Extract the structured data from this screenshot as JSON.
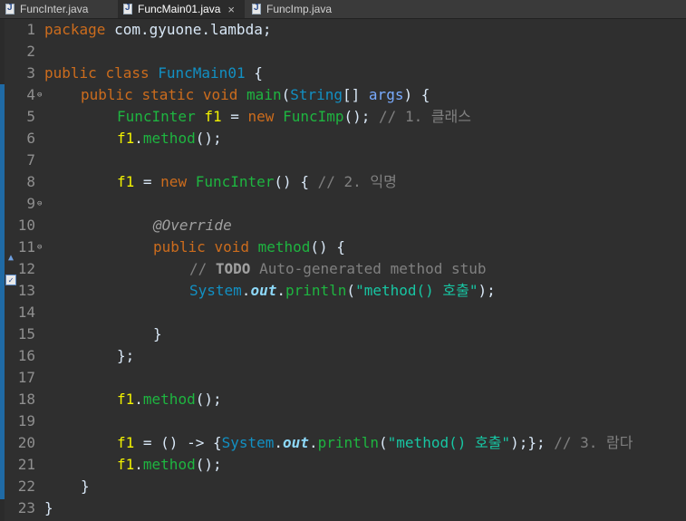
{
  "tabs": [
    {
      "label": "FuncInter.java",
      "active": false
    },
    {
      "label": "FuncMain01.java",
      "active": true,
      "close": "×"
    },
    {
      "label": "FuncImp.java",
      "active": false
    }
  ],
  "colors": {
    "keyword": "#cc6c1d",
    "class": "#1290c3",
    "method": "#1eb540",
    "string": "#17c6a3",
    "comment": "#808080",
    "background": "#2f2f2f"
  },
  "line_numbers": [
    "1",
    "2",
    "3",
    "4",
    "5",
    "6",
    "7",
    "8",
    "9",
    "10",
    "11",
    "12",
    "13",
    "14",
    "15",
    "16",
    "17",
    "18",
    "19",
    "20",
    "21",
    "22",
    "23"
  ],
  "fold_markers": {
    "4": "⊖",
    "8": "⊖",
    "10": "⊖"
  },
  "code": {
    "l1": {
      "kw": "package",
      "rest": " com.gyuone.lambda;"
    },
    "l3": {
      "kw1": "public",
      "kw2": "class",
      "name": "FuncMain01",
      "rest": " {"
    },
    "l4": {
      "kw1": "public",
      "kw2": "static",
      "kw3": "void",
      "name": "main",
      "p1": "(",
      "type": "String",
      "p2": "[] ",
      "param": "args",
      "p3": ") {"
    },
    "l5": {
      "type": "FuncInter",
      "var": "f1",
      "eq": " = ",
      "kw": "new",
      "cls": "FuncImp",
      "p": "();",
      "cmt": " // 1. 클래스"
    },
    "l6": {
      "var": "f1",
      "dot": ".",
      "meth": "method",
      "p": "();"
    },
    "l8": {
      "var": "f1",
      "eq": " = ",
      "kw": "new",
      "cls": "FuncInter",
      "p": "() {",
      "cmt": " // 2. 익명"
    },
    "l10": {
      "ann": "@Override"
    },
    "l11": {
      "kw1": "public",
      "kw2": "void",
      "meth": "method",
      "p": "() {"
    },
    "l12": {
      "c1": "// ",
      "todo": "TODO",
      "c2": " Auto-generated method stub"
    },
    "l13": {
      "cls": "System",
      "dot1": ".",
      "fld": "out",
      "dot2": ".",
      "meth": "println",
      "p1": "(",
      "str": "\"method() 호출\"",
      "p2": ");"
    },
    "l15": {
      "text": "}"
    },
    "l16": {
      "text": "};"
    },
    "l18": {
      "var": "f1",
      "dot": ".",
      "meth": "method",
      "p": "();"
    },
    "l20": {
      "var": "f1",
      "mid": " = () -> {",
      "cls": "System",
      "dot1": ".",
      "fld": "out",
      "dot2": ".",
      "meth": "println",
      "p1": "(",
      "str": "\"method() 호출\"",
      "p2": ");};",
      "cmt": " // 3. 람다"
    },
    "l21": {
      "var": "f1",
      "dot": ".",
      "meth": "method",
      "p": "();"
    },
    "l22": {
      "text": "}"
    },
    "l23": {
      "text": "}"
    }
  }
}
